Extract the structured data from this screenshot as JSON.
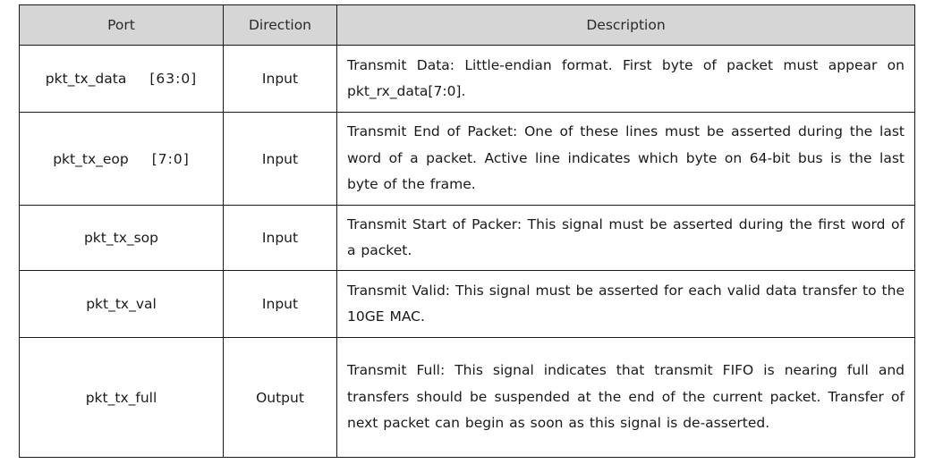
{
  "table": {
    "headers": {
      "port": "Port",
      "direction": "Direction",
      "description": "Description"
    },
    "rows": [
      {
        "port": "pkt_tx_data",
        "range": "[63:0]",
        "direction": "Input",
        "description": "Transmit Data: Little-endian format. First byte of packet must appear on pkt_rx_data[7:0]."
      },
      {
        "port": "pkt_tx_eop",
        "range": "[7:0]",
        "direction": "Input",
        "description": "Transmit End of Packet: One of these lines must be asserted during the last word of a packet. Active line indicates which byte on 64-bit bus is the last byte of the frame."
      },
      {
        "port": "pkt_tx_sop",
        "range": "",
        "direction": "Input",
        "description": "Transmit Start of Packer: This signal must be asserted during the first word of a packet."
      },
      {
        "port": "pkt_tx_val",
        "range": "",
        "direction": "Input",
        "description": "Transmit Valid: This signal must be asserted for each valid data transfer to the 10GE MAC."
      },
      {
        "port": "pkt_tx_full",
        "range": "",
        "direction": "Output",
        "description": "Transmit Full: This signal indicates that transmit FIFO is nearing full and transfers should be suspended at the end of the current packet. Transfer of next packet can begin as soon as this signal is de-asserted."
      }
    ]
  },
  "colors": {
    "header_background": "#d6d6d6",
    "border": "#1a1a1a",
    "text": "#1a1a1a"
  }
}
